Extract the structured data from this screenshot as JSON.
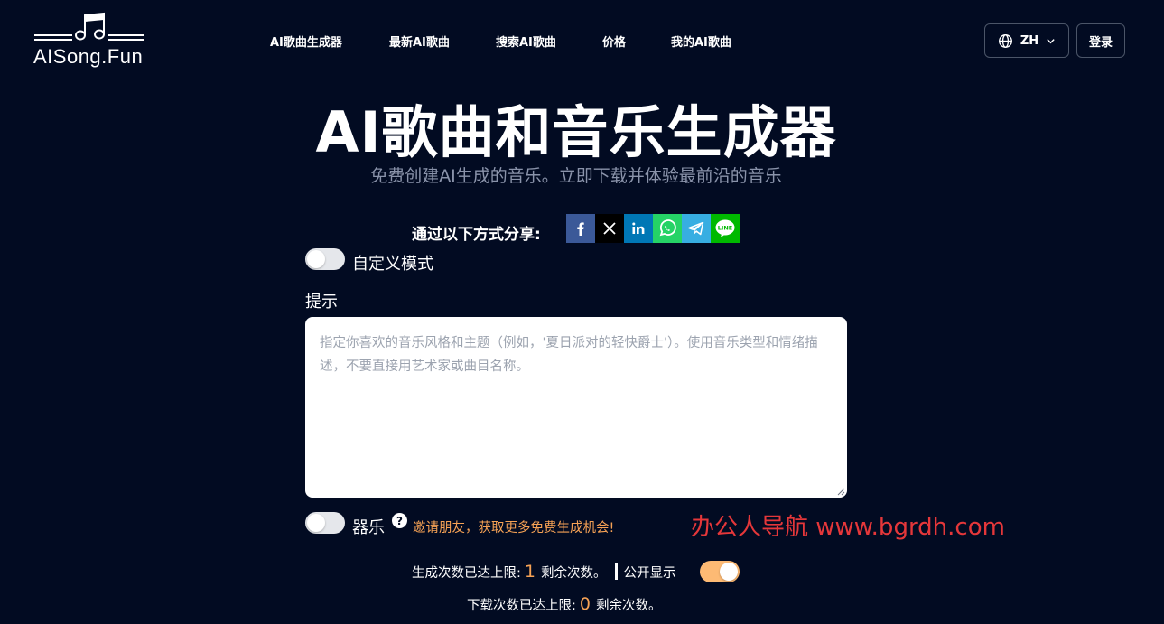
{
  "header": {
    "logo_text": "AISong.Fun",
    "nav": [
      {
        "label": "AI歌曲生成器"
      },
      {
        "label": "最新AI歌曲"
      },
      {
        "label": "搜索AI歌曲"
      },
      {
        "label": "价格"
      },
      {
        "label": "我的AI歌曲"
      }
    ],
    "language": {
      "label": "ZH",
      "icon": "globe-icon"
    },
    "login_label": "登录"
  },
  "hero": {
    "title": "AI歌曲和音乐生成器",
    "subtitle": "免费创建AI生成的音乐。立即下载并体验最前沿的音乐"
  },
  "share": {
    "label": "通过以下方式分享:",
    "buttons": [
      {
        "name": "facebook",
        "glyph": "f",
        "color": "#3b5998"
      },
      {
        "name": "x",
        "glyph": "𝕏",
        "color": "#000000"
      },
      {
        "name": "linkedin",
        "glyph": "in",
        "color": "#0077b5"
      },
      {
        "name": "whatsapp",
        "glyph": "whatsapp-icon",
        "color": "#25d366"
      },
      {
        "name": "telegram",
        "glyph": "telegram-icon",
        "color": "#37aee2"
      },
      {
        "name": "line",
        "glyph": "LINE",
        "color": "#00b900"
      }
    ]
  },
  "form": {
    "custom_mode": {
      "label": "自定义模式",
      "enabled": false
    },
    "prompt": {
      "label": "提示",
      "value": "",
      "placeholder": "指定你喜欢的音乐风格和主题（例如，'夏日派对的轻快爵士'）。使用音乐类型和情绪描述，不要直接用艺术家或曲目名称。"
    },
    "instrumental": {
      "label": "器乐",
      "enabled": false,
      "help_glyph": "?"
    },
    "invite_text": "邀请朋友，获取更多免费生成机会!"
  },
  "watermark": "办公人导航 www.bgrdh.com",
  "status": {
    "generation": {
      "prefix": "生成次数已达上限:",
      "count": "1",
      "suffix": "剩余次数。"
    },
    "public_display": {
      "label": "公开显示",
      "enabled": true
    },
    "download": {
      "prefix": "下载次数已达上限:",
      "count": "0",
      "suffix": "剩余次数。"
    }
  },
  "colors": {
    "background": "#020b22",
    "accent": "#f6a255",
    "watermark": "#e5373a"
  }
}
